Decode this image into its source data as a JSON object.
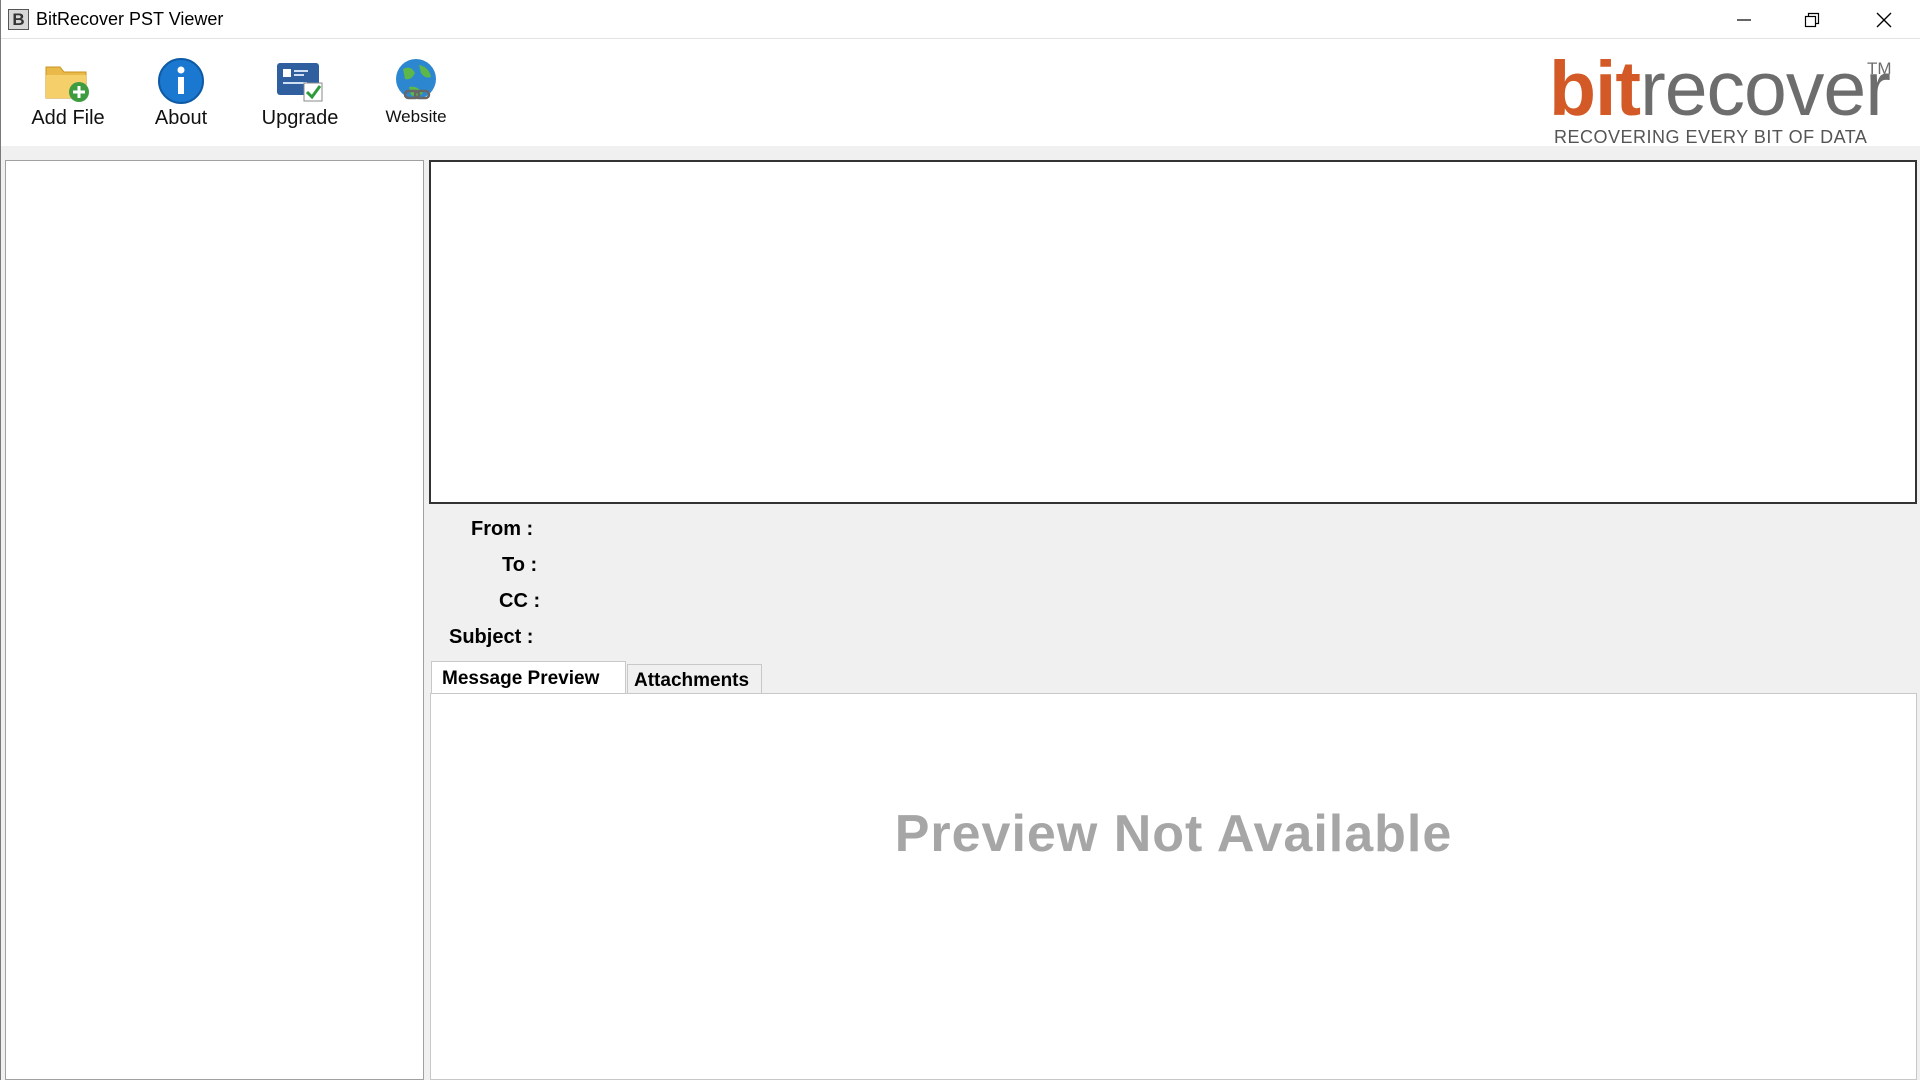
{
  "window": {
    "title": "BitRecover PST Viewer",
    "app_icon_letter": "B"
  },
  "toolbar": {
    "add_file": "Add File",
    "about": "About",
    "upgrade": "Upgrade",
    "website": "Website"
  },
  "brand": {
    "bit": "bit",
    "rest": "recover",
    "tm": "TM",
    "tagline": "RECOVERING EVERY BIT OF DATA"
  },
  "fields": {
    "from": "From :",
    "to": "To :",
    "cc": "CC :",
    "subject": "Subject :"
  },
  "tabs": {
    "message_preview": "Message Preview",
    "attachments": "Attachments"
  },
  "preview": {
    "placeholder": "Preview Not Available"
  },
  "colors": {
    "brand_orange": "#d35a26",
    "brand_gray": "#6d6d6d",
    "panel_bg": "#f0f0f0"
  }
}
